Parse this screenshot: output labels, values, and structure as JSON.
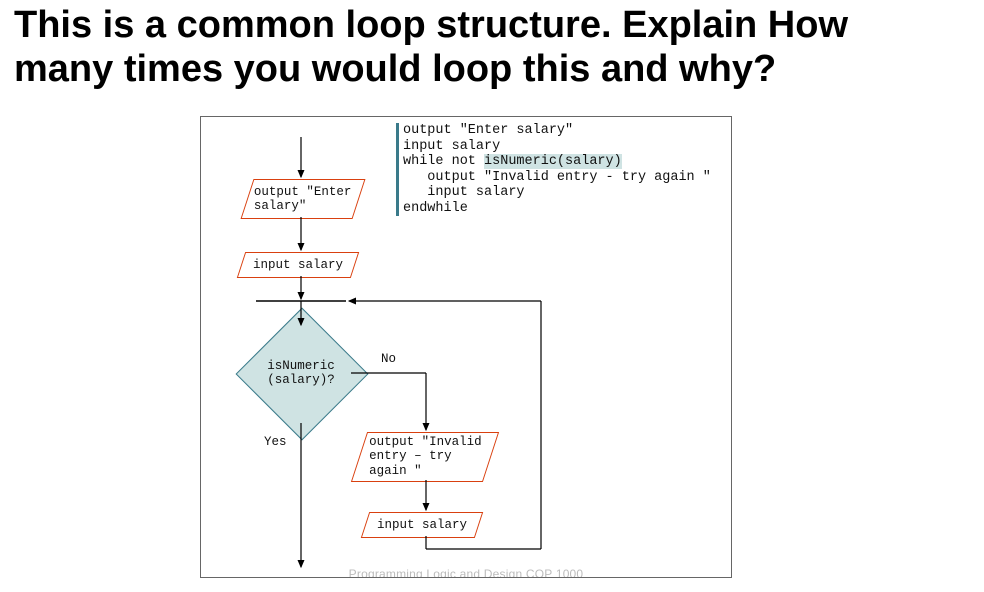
{
  "title_line1": "This is a common loop structure. Explain How",
  "title_line2": "many times you would loop this and why?",
  "flow": {
    "io_prompt": "output \"Enter\nsalary\"",
    "io_input1": "input salary",
    "decision": "isNumeric\n(salary)?",
    "label_no": "No",
    "label_yes": "Yes",
    "io_error": "output \"Invalid\nentry – try\nagain \"",
    "io_input2": "input salary"
  },
  "pseudocode": {
    "l1": "output \"Enter salary\"",
    "l2": "input salary",
    "l3a": "while not ",
    "l3b": "isNumeric(salary)",
    "l4": "   output \"Invalid entry - try again \"",
    "l5": "   input salary",
    "l6": "endwhile"
  },
  "footer": "Programming Logic and Design COP 1000"
}
